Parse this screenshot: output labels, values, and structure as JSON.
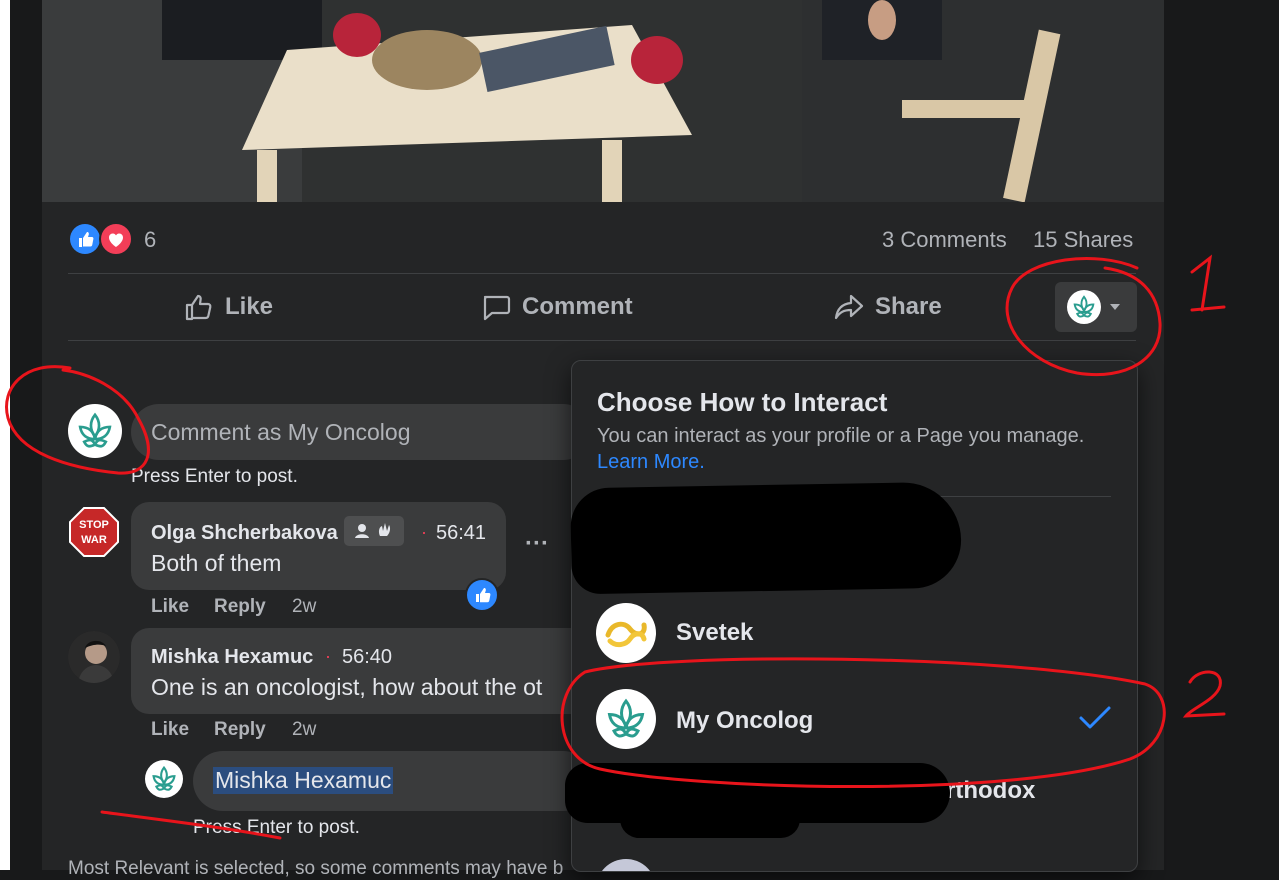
{
  "post": {
    "reaction_count": "6",
    "comments_count": "3 Comments",
    "shares_count": "15 Shares"
  },
  "actions": {
    "like": "Like",
    "comment": "Comment",
    "share": "Share"
  },
  "composer": {
    "placeholder": "Comment as My Oncolog",
    "hint": "Press Enter to post."
  },
  "comments": [
    {
      "author": "Olga Shcherbakova",
      "avatar_text": "STOP WAR",
      "time": "56:41",
      "text": "Both of them",
      "like": "Like",
      "reply": "Reply",
      "age": "2w"
    },
    {
      "author": "Mishka Hexamuc",
      "time": "56:40",
      "text": "One is an oncologist, how about the ot",
      "like": "Like",
      "reply": "Reply",
      "age": "2w"
    }
  ],
  "reply_box": {
    "value": "Mishka Hexamuc",
    "hint": "Press Enter to post."
  },
  "footer_note": "Most Relevant is selected, so some comments may have b",
  "interact_menu": {
    "title": "Choose How to Interact",
    "subtitle": "You can interact as your profile or a Page you manage.",
    "learn_more": "Learn More.",
    "options": [
      {
        "label": "Svetek",
        "selected": false
      },
      {
        "label": "My Oncolog",
        "selected": true
      }
    ],
    "partial_label": "rthodox"
  },
  "annotations": {
    "marker_1": "1",
    "marker_2": "2"
  },
  "colors": {
    "accent_blue": "#2d88ff",
    "brand_teal": "#2a9d8f",
    "annotation_red": "#e8141b",
    "love_red": "#f33e58"
  }
}
